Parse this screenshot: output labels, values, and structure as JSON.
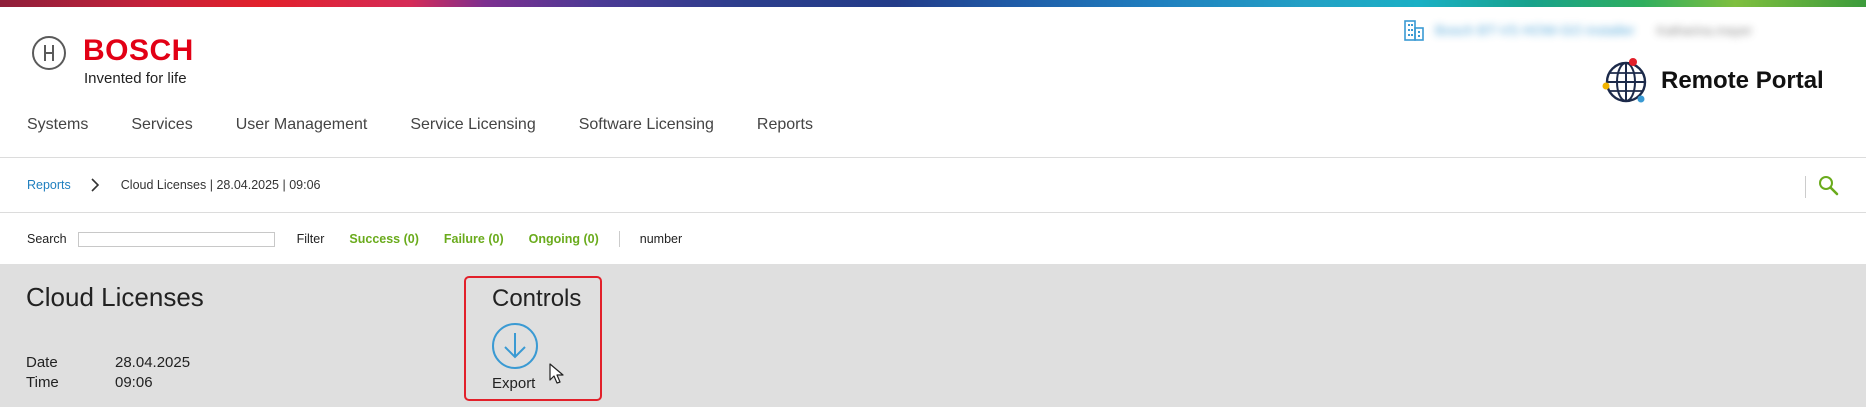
{
  "brand": {
    "name": "BOSCH",
    "tagline": "Invented for life",
    "portal_title": "Remote Portal",
    "accent_color": "#e20015"
  },
  "user": {
    "organization": "Bosch BT-VS HOW-GO installer",
    "name": "Katharina.mayer"
  },
  "nav": {
    "items": [
      {
        "label": "Systems"
      },
      {
        "label": "Services"
      },
      {
        "label": "User Management"
      },
      {
        "label": "Service Licensing"
      },
      {
        "label": "Software Licensing"
      },
      {
        "label": "Reports"
      }
    ]
  },
  "breadcrumb": {
    "parent": "Reports",
    "current": "Cloud Licenses | 28.04.2025 | 09:06"
  },
  "filterbar": {
    "search_label": "Search",
    "search_value": "",
    "filter_label": "Filter",
    "success": "Success (0)",
    "failure": "Failure (0)",
    "ongoing": "Ongoing (0)",
    "number": "number",
    "status_color": "#6aab1c"
  },
  "report": {
    "title": "Cloud Licenses",
    "date_label": "Date",
    "date_value": "28.04.2025",
    "time_label": "Time",
    "time_value": "09:06"
  },
  "controls": {
    "title": "Controls",
    "export_label": "Export",
    "highlight_color": "#e2202a"
  },
  "icons": {
    "building": "building-icon",
    "globe": "globe-icon",
    "chevron": "chevron-right-icon",
    "search": "search-icon",
    "download": "download-icon",
    "cursor": "mouse-cursor-icon"
  }
}
